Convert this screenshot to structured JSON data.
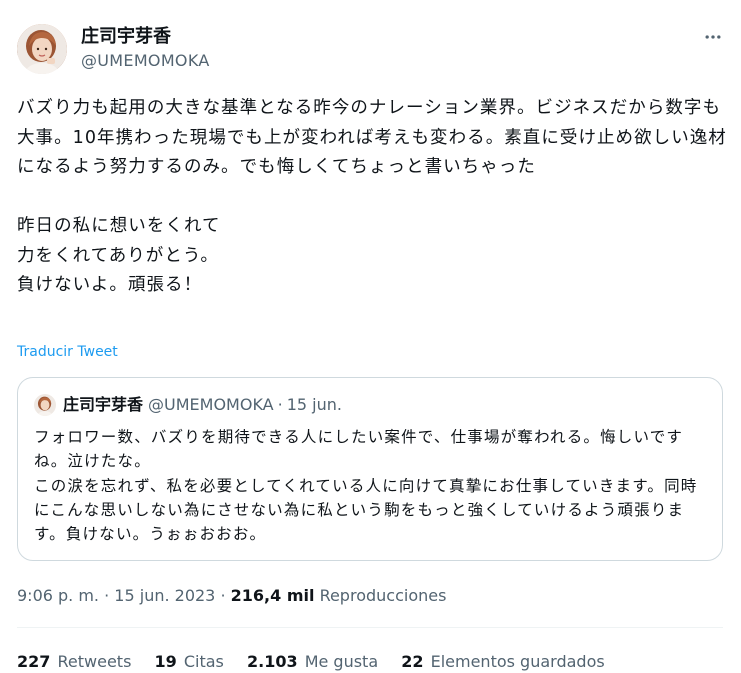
{
  "author": {
    "display_name": "庄司宇芽香",
    "handle": "@UMEMOMOKA"
  },
  "more_icon": "more-horizontal-icon",
  "tweet": {
    "text": "バズり力も起用の大きな基準となる昨今のナレーション業界。ビジネスだから数字も大事。10年携わった現場でも上が変われば考えも変わる。素直に受け止め欲しい逸材になるよう努力するのみ。でも悔しくてちょっと書いちゃった\n\n昨日の私に想いをくれて\n力をくれてありがとう。\n負けないよ。頑張る！",
    "translate_label": "Traducir Tweet"
  },
  "quoted_tweet": {
    "display_name": "庄司宇芽香",
    "handle": "@UMEMOMOKA",
    "separator": "·",
    "date": "15 jun.",
    "text": "フォロワー数、バズりを期待できる人にしたい案件で、仕事場が奪われる。悔しいですね。泣けたな。\nこの涙を忘れず、私を必要としてくれている人に向けて真摯にお仕事していきます。同時にこんな思いしない為にさせない為に私という駒をもっと強くしていけるよう頑張ります。負けない。うぉぉおおお。"
  },
  "meta": {
    "time": "9:06 p. m.",
    "separator": "·",
    "date": "15 jun. 2023",
    "views_count": "216,4 mil",
    "views_label": "Reproducciones"
  },
  "stats": [
    {
      "count": "227",
      "label": "Retweets"
    },
    {
      "count": "19",
      "label": "Citas"
    },
    {
      "count": "2.103",
      "label": "Me gusta"
    },
    {
      "count": "22",
      "label": "Elementos guardados"
    }
  ]
}
